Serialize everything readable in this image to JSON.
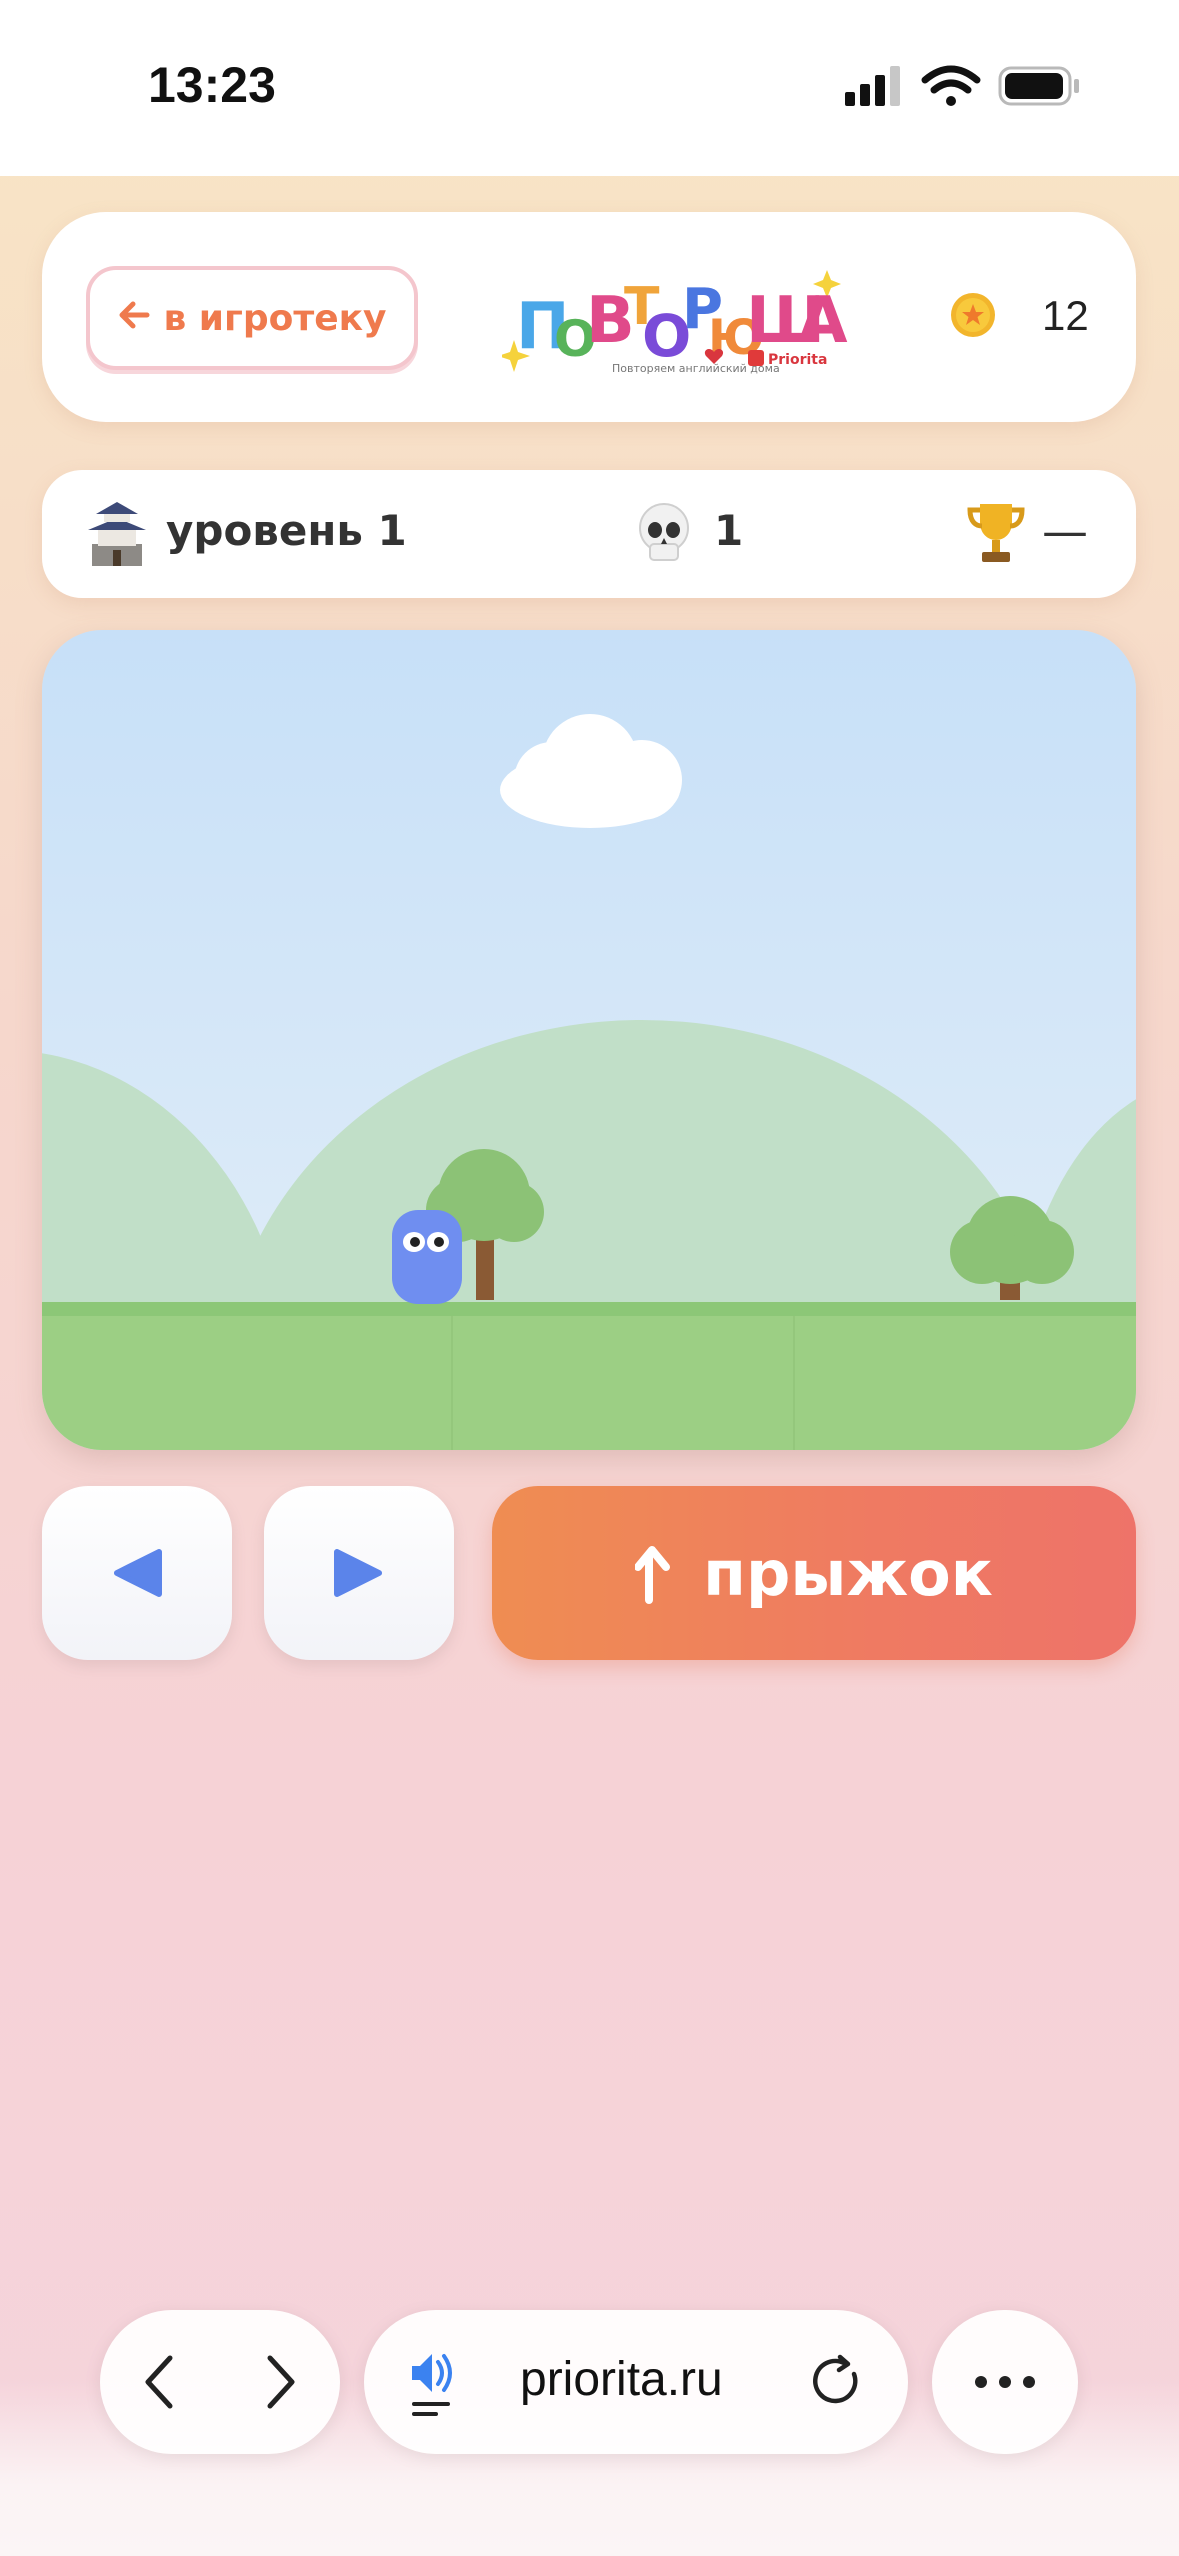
{
  "status_bar": {
    "time": "13:23"
  },
  "header": {
    "back_label": "в игротеку",
    "logo_text": "ПОВТОРЮША",
    "logo_tagline": "Повторяем английский дома",
    "logo_brand": "Priorita",
    "coins": "12"
  },
  "stats": {
    "level_label": "уровень 1",
    "deaths": "1",
    "best": "—"
  },
  "controls": {
    "jump_label": "прыжок"
  },
  "browser": {
    "url": "priorita.ru"
  },
  "colors": {
    "accent_orange": "#ef7a4d",
    "jump_gradient_start": "#ef8d52",
    "jump_gradient_end": "#ee7369",
    "player_blue": "#6f8ef0",
    "arrow_blue": "#5b84ea",
    "grass": "#9ccf84"
  },
  "icons": {
    "back": "arrow-left-icon",
    "coin": "coin-icon",
    "level": "castle-icon",
    "deaths": "skull-icon",
    "best": "trophy-icon",
    "left": "triangle-left-icon",
    "right": "triangle-right-icon",
    "jump": "arrow-up-icon"
  }
}
